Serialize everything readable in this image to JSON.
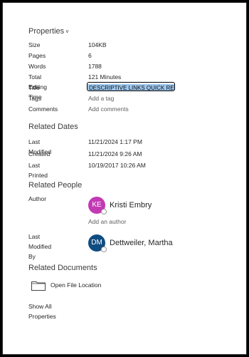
{
  "properties": {
    "heading": "Properties",
    "items": [
      {
        "label": "Size",
        "value": "104KB"
      },
      {
        "label": "Pages",
        "value": "6"
      },
      {
        "label": "Words",
        "value": "1788"
      },
      {
        "label": "Total Editing Time",
        "value": "121 Minutes"
      },
      {
        "label": "Title",
        "value": "DESCRIPTIVE LINKS QUICK REFE"
      },
      {
        "label": "Tags",
        "value": "Add a tag"
      },
      {
        "label": "Comments",
        "value": "Add comments"
      }
    ]
  },
  "related_dates": {
    "heading": "Related Dates",
    "items": [
      {
        "label": "Last Modified",
        "value": "11/21/2024 1:17 PM"
      },
      {
        "label": "Created",
        "value": "11/21/2024 9:26 AM"
      },
      {
        "label": "Last Printed",
        "value": "10/19/2017 10:26 AM"
      }
    ]
  },
  "related_people": {
    "heading": "Related People",
    "author_label": "Author",
    "author": {
      "initials": "KE",
      "name": "Kristi Embry",
      "color": "#c239b3"
    },
    "add_author": "Add an author",
    "modified_by_label": "Last Modified By",
    "modified_by": {
      "initials": "DM",
      "name": "Dettweiler, Martha",
      "color": "#0f4c81"
    }
  },
  "related_documents": {
    "heading": "Related Documents",
    "open_location": "Open File Location"
  },
  "show_all": "Show All Properties",
  "icons": [
    "chevron-down-icon",
    "folder-icon",
    "presence-icon"
  ]
}
